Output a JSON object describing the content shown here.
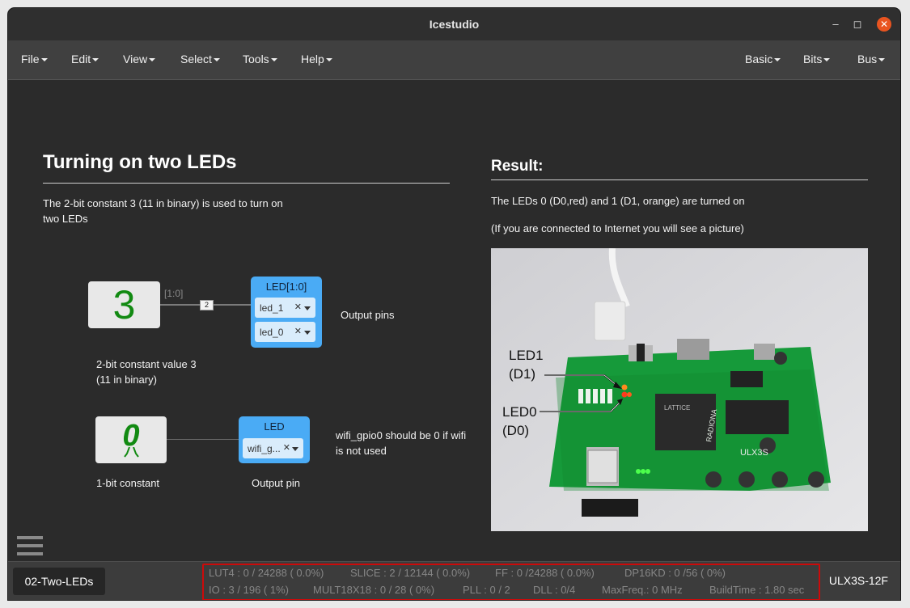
{
  "window": {
    "title": "Icestudio"
  },
  "menu": {
    "left": [
      "File",
      "Edit",
      "View",
      "Select",
      "Tools",
      "Help"
    ],
    "right": [
      "Basic",
      "Bits",
      "Bus"
    ]
  },
  "left_panel": {
    "heading": "Turning on two LEDs",
    "desc_line1": "The 2-bit constant 3 (11 in binary) is used to turn on",
    "desc_line2": "two LEDs",
    "const1": {
      "value": "3",
      "label_line1": "2-bit constant value 3",
      "label_line2": "(11 in binary)",
      "wire_range": "[1:0]",
      "wire_width": "2"
    },
    "led_block": {
      "title": "LED[1:0]",
      "pins": [
        "led_1",
        "led_0"
      ],
      "note": "Output pins"
    },
    "const2": {
      "value": "0",
      "label": "1-bit constant"
    },
    "led_block2": {
      "title": "LED",
      "pin": "wifi_g...",
      "label": "Output pin",
      "note_line1": "wifi_gpio0 should be 0 if wifi",
      "note_line2": "is not used"
    }
  },
  "right_panel": {
    "heading": "Result:",
    "line1": "The LEDs 0 (D0,red) and 1 (D1, orange) are turned on",
    "line2": "(If you are connected to Internet you will see a picture)",
    "photo": {
      "led1_label_a": "LED1",
      "led1_label_b": "(D1)",
      "led0_label_a": "LED0",
      "led0_label_b": "(D0)",
      "board_text_1": "ULX3S",
      "board_text_2": "LATTICE",
      "board_text_3": "RADIONA"
    }
  },
  "status": {
    "project": "02-Two-LEDs",
    "lut4": "LUT4 : 0 / 24288 ( 0.0%)",
    "slice": "SLICE : 2 / 12144 ( 0.0%)",
    "ff": "FF :  0 /24288  ( 0.0%)",
    "dp16kd": "DP16KD :  0 /56  ( 0%)",
    "io": "IO : 3 / 196 ( 1%)",
    "mult": "MULT18X18 : 0 / 28 ( 0%)",
    "pll": "PLL : 0 / 2",
    "dll": "DLL :  0/4",
    "maxfreq": "MaxFreq.:  0 MHz",
    "buildtime": "BuildTime :  1.80 sec",
    "board": "ULX3S-12F"
  },
  "colors": {
    "accent_close": "#e95420",
    "led_block": "#4aabf5",
    "const_green": "#128a12",
    "stats_border": "#cc0a0a"
  }
}
